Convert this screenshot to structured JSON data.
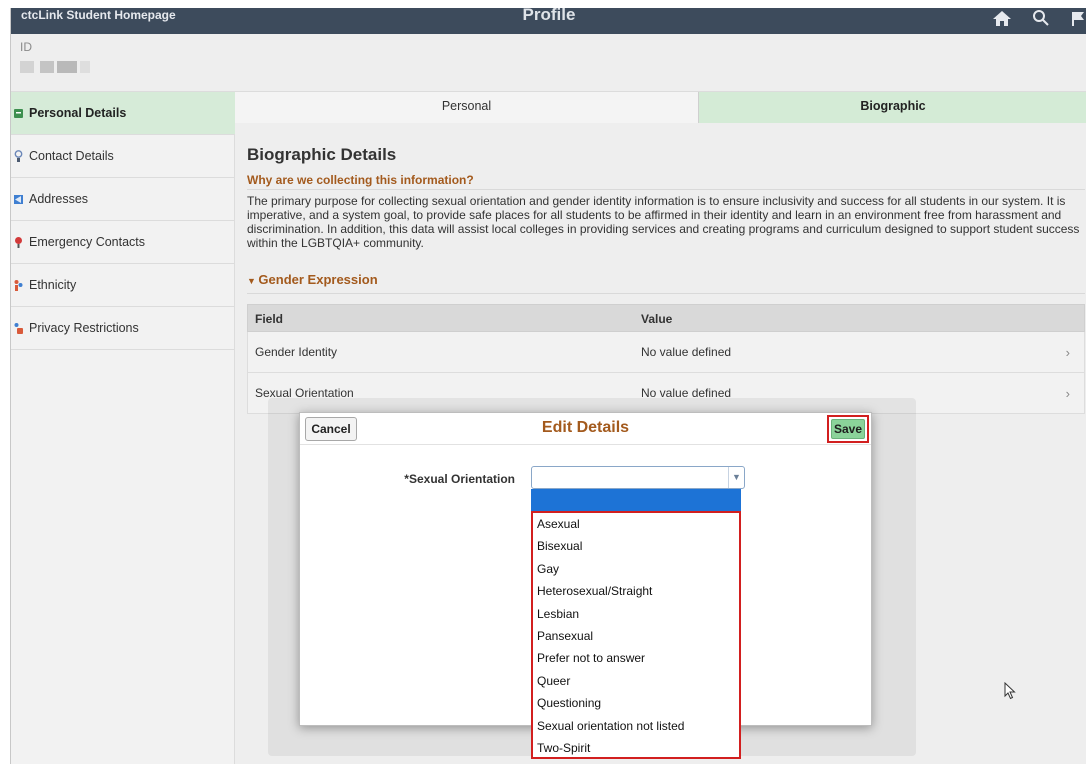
{
  "header": {
    "home_link": "ctcLink Student Homepage",
    "page_title": "Profile",
    "icons": [
      "home-icon",
      "search-icon",
      "flag-icon"
    ]
  },
  "id_bar": {
    "label": "ID"
  },
  "sidebar": {
    "items": [
      {
        "label": "Personal Details",
        "icon": "personal-details-icon",
        "active": true
      },
      {
        "label": "Contact Details",
        "icon": "contact-details-icon",
        "active": false
      },
      {
        "label": "Addresses",
        "icon": "addresses-icon",
        "active": false
      },
      {
        "label": "Emergency Contacts",
        "icon": "emergency-contacts-icon",
        "active": false
      },
      {
        "label": "Ethnicity",
        "icon": "ethnicity-icon",
        "active": false
      },
      {
        "label": "Privacy Restrictions",
        "icon": "privacy-restrictions-icon",
        "active": false
      }
    ]
  },
  "tabs": [
    {
      "label": "Personal",
      "active": false
    },
    {
      "label": "Biographic",
      "active": true
    }
  ],
  "content": {
    "title": "Biographic Details",
    "why_heading": "Why are we collecting this information?",
    "purpose_text": "The primary purpose for collecting sexual orientation and gender identity information is to ensure inclusivity and success for all students in our system. It is imperative, and a system goal, to provide safe places for all students to be affirmed in their identity and learn in an environment free from harassment and discrimination. In addition, this data will assist local colleges in providing services and creating programs and curriculum designed to support student success within the LGBTQIA+ community.",
    "gender_section": "Gender Expression",
    "grid": {
      "headers": [
        "Field",
        "Value"
      ],
      "rows": [
        {
          "field": "Gender Identity",
          "value": "No value defined"
        },
        {
          "field": "Sexual Orientation",
          "value": "No value defined"
        }
      ]
    }
  },
  "modal": {
    "title": "Edit Details",
    "cancel_label": "Cancel",
    "save_label": "Save",
    "field_label": "*Sexual Orientation",
    "selected_value": "",
    "options": [
      "Asexual",
      "Bisexual",
      "Gay",
      "Heterosexual/Straight",
      "Lesbian",
      "Pansexual",
      "Prefer not to answer",
      "Queer",
      "Questioning",
      "Sexual orientation not listed",
      "Two-Spirit"
    ]
  },
  "colors": {
    "banner": "#3d4b5c",
    "active_green": "#d6ebd8",
    "accent_orange": "#a35a1d",
    "save_green": "#8bd39a",
    "highlight_red": "#d21f1f",
    "selection_blue": "#1d73d6"
  }
}
